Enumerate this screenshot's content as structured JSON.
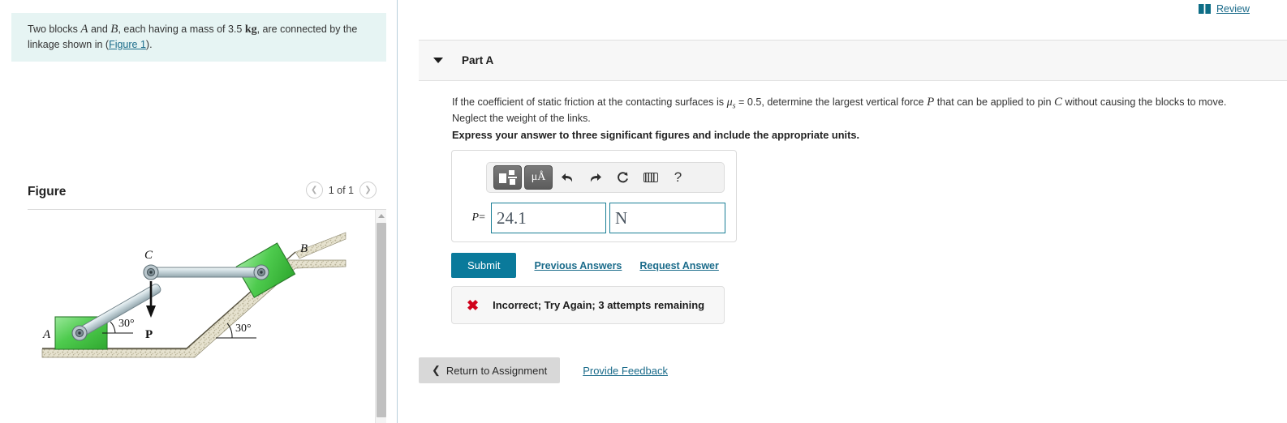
{
  "problem": {
    "text_part1": "Two blocks ",
    "var_a": "A",
    "text_and": " and ",
    "var_b": "B",
    "text_part2": ", each having a mass of 3.5 ",
    "unit_kg": "kg",
    "text_part3": ", are connected by the linkage shown in (",
    "figure_link": "Figure 1",
    "text_part4": ")."
  },
  "figure": {
    "title": "Figure",
    "pager_label": "1 of 1",
    "prev_icon": "chevron-left-icon",
    "next_icon": "chevron-right-icon",
    "labels": {
      "block_a": "A",
      "block_b": "B",
      "pin_c": "C",
      "force_p": "P",
      "angle_link": "30°",
      "angle_incline": "30°"
    }
  },
  "header": {
    "review_label": "Review",
    "review_icon": "book-icon"
  },
  "part": {
    "title": "Part A",
    "caret_icon": "caret-down-icon",
    "question_p1": "If the coefficient of static friction at the contacting surfaces is ",
    "question_mu": "μ",
    "question_mu_sub": "s",
    "question_p2": " = 0.5, determine the largest vertical force ",
    "question_var_p": "P",
    "question_p3": " that can be applied to pin ",
    "question_var_c": "C",
    "question_p4": " without causing the blocks to move. Neglect the weight of the links.",
    "instruction": "Express your answer to three significant figures and include the appropriate units."
  },
  "toolbar": {
    "template_icon": "math-template-icon",
    "units_label": "μÅ",
    "units_icon": "units-icon",
    "undo_icon": "undo-icon",
    "redo_icon": "redo-icon",
    "reset_icon": "reset-icon",
    "keyboard_icon": "keyboard-icon",
    "help_label": "?"
  },
  "answer": {
    "label_var": "P",
    "label_eq": "=",
    "value": "24.1",
    "unit": "N",
    "value_placeholder": "",
    "unit_placeholder": ""
  },
  "actions": {
    "submit_label": "Submit",
    "previous_answers_label": "Previous Answers",
    "request_answer_label": "Request Answer",
    "return_label": "Return to Assignment",
    "return_icon": "chevron-left-icon",
    "provide_feedback_label": "Provide Feedback"
  },
  "feedback": {
    "icon": "x-mark-icon",
    "message": "Incorrect; Try Again; 3 attempts remaining",
    "icon_color": "#d0021b"
  },
  "colors": {
    "accent": "#0a7a9b",
    "link": "#1a6b8a",
    "problem_bg": "#e6f4f3",
    "panel_bg": "#f7f7f7",
    "error": "#d0021b",
    "block_green": "#5dd05d",
    "link_bar_gray": "#c7d4d8"
  }
}
